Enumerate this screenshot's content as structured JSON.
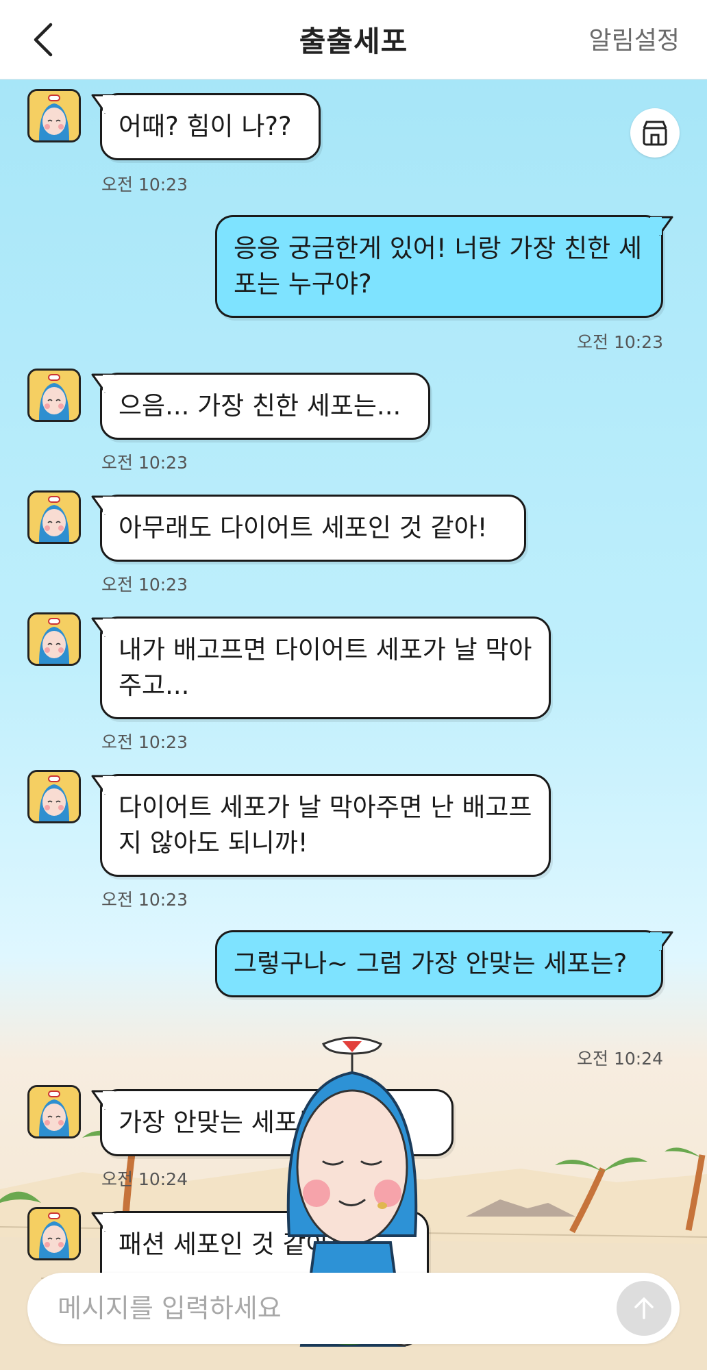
{
  "header": {
    "title": "출출세포",
    "notification_label": "알림설정"
  },
  "icons": {
    "back": "chevron-left-icon",
    "store": "store-icon",
    "send": "arrow-up-icon",
    "character": "cell-character"
  },
  "colors": {
    "user_bubble": "#7ee3ff",
    "bot_bubble": "#ffffff",
    "avatar_bg": "#f5cf62",
    "sky": "#a7e6f8",
    "sand": "#f3e5cd"
  },
  "messages": [
    {
      "from": "bot",
      "text": "어때? 힘이 나??",
      "time": "오전 10:23"
    },
    {
      "from": "user",
      "text": "응응 궁금한게 있어! 너랑 가장 친한 세포는 누구야?",
      "time": "오전 10:23"
    },
    {
      "from": "bot",
      "text": "으음... 가장 친한 세포는...",
      "time": "오전 10:23"
    },
    {
      "from": "bot",
      "text": "아무래도 다이어트 세포인 것 같아!",
      "time": "오전 10:23"
    },
    {
      "from": "bot",
      "text": "내가 배고프면 다이어트 세포가 날 막아주고...",
      "time": "오전 10:23"
    },
    {
      "from": "bot",
      "text": "다이어트 세포가 날 막아주면 난 배고프지 않아도 되니까!",
      "time": "오전 10:23"
    },
    {
      "from": "user",
      "text": "그렇구나~ 그럼 가장 안맞는 세포는?",
      "time": "오전 10:24"
    },
    {
      "from": "bot",
      "text": "가장 안맞는 세포는...",
      "time": "오전 10:24"
    },
    {
      "from": "bot",
      "text": "패션 세포인 것 같아!",
      "time": ""
    }
  ],
  "input": {
    "placeholder": "메시지를 입력하세요",
    "value": ""
  }
}
